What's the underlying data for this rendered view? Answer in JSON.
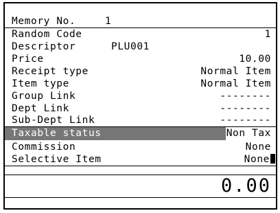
{
  "header": {
    "memory_label": "Memory No.",
    "memory_value": "1"
  },
  "fields": {
    "random_code": {
      "label": "Random Code",
      "value": "1"
    },
    "descriptor": {
      "label": "Descriptor",
      "value": "PLU001"
    },
    "price": {
      "label": "Price",
      "value": "10.00"
    },
    "receipt_type": {
      "label": "Receipt type",
      "value": "Normal Item"
    },
    "item_type": {
      "label": "Item type",
      "value": "Normal Item"
    },
    "group_link": {
      "label": "Group Link",
      "value": "--------"
    },
    "dept_link": {
      "label": "Dept Link",
      "value": "--------"
    },
    "subdept_link": {
      "label": "Sub-Dept Link",
      "value": "--------"
    },
    "taxable_status": {
      "label": "Taxable status",
      "value": "Non Tax"
    },
    "commission": {
      "label": "Commission",
      "value": "None"
    },
    "selective_item": {
      "label": "Selective Item",
      "value": "None"
    }
  },
  "total": "0.00",
  "colors": {
    "highlight": "#777777",
    "text": "#000000",
    "background": "#ffffff"
  }
}
